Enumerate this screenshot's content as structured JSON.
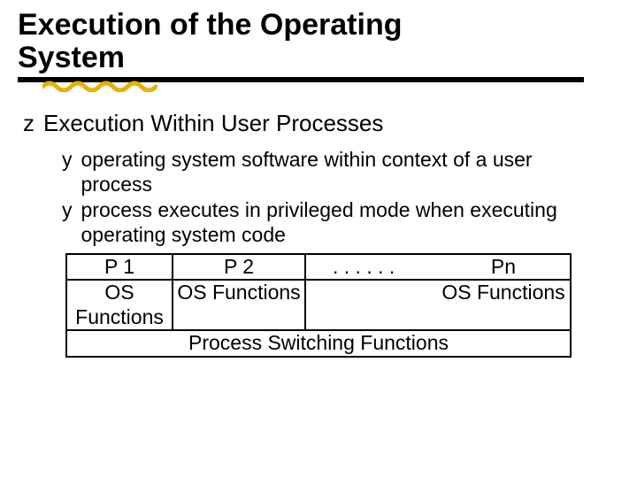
{
  "title_line1": "Execution of the Operating",
  "title_line2": "System",
  "bullet_z": "z",
  "bullet_y": "y",
  "lvl1_text": "Execution Within User Processes",
  "lvl2_items": [
    "operating system software within context of a user process",
    "process executes in privileged mode when executing operating system code"
  ],
  "diagram": {
    "row1": {
      "p1": "P 1",
      "p2": "P 2",
      "dots": ". . . . . .",
      "pn": "Pn"
    },
    "row2": {
      "c1": "OS Functions",
      "c2": "OS Functions",
      "c3": "",
      "c4": "OS Functions"
    },
    "row3": "Process Switching Functions"
  }
}
